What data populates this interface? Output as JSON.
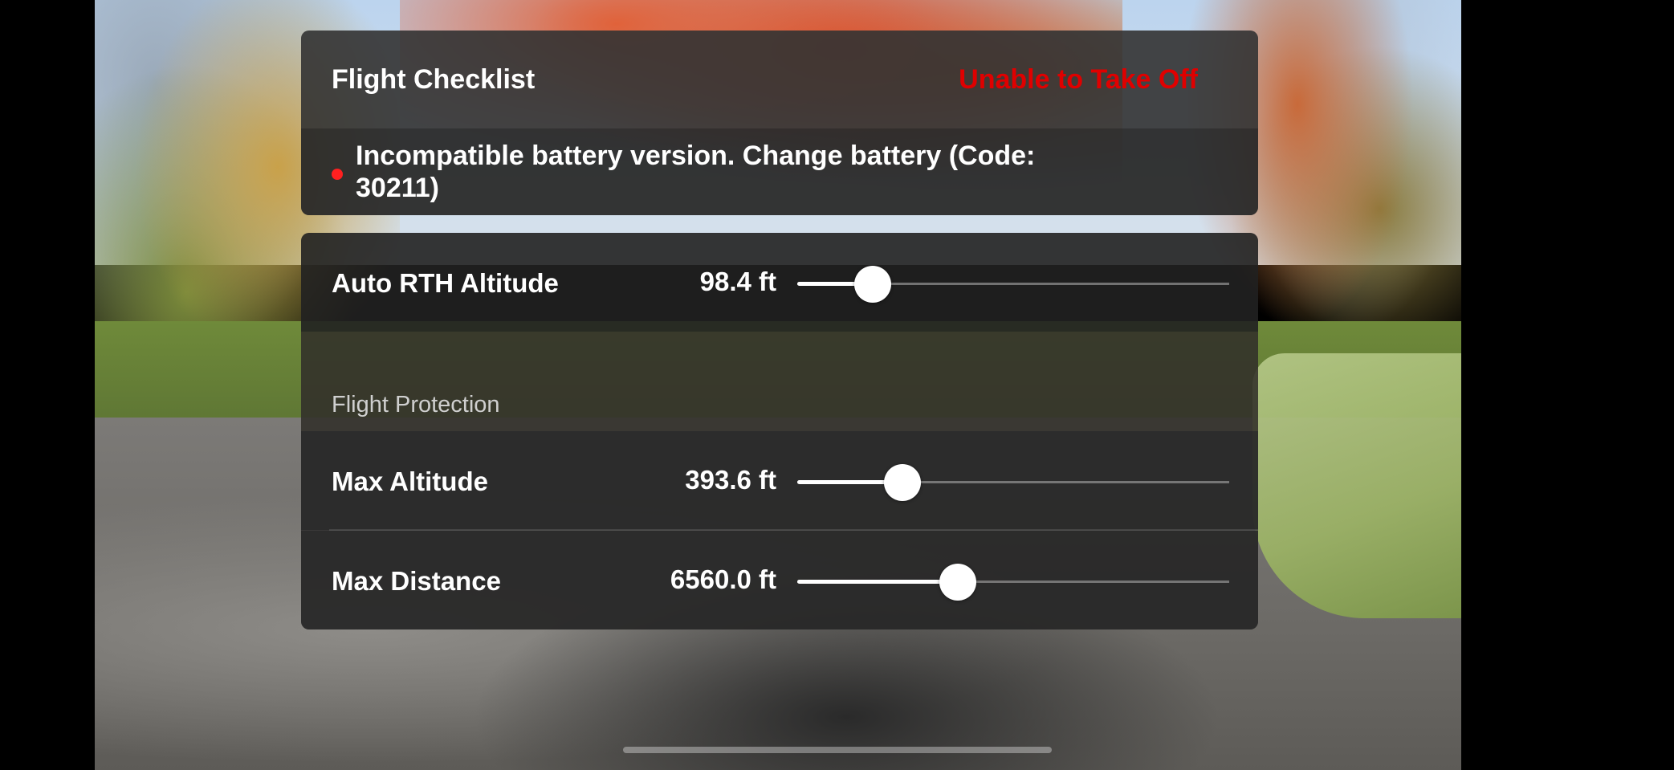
{
  "checklist": {
    "title": "Flight Checklist",
    "status": "Unable to Take Off",
    "status_color": "#e00000",
    "error_message": "Incompatible battery version. Change battery (Code: 30211)",
    "error_dot_color": "#ff2020"
  },
  "settings": {
    "rth": {
      "label": "Auto RTH Altitude",
      "value_text": "98.4 ft",
      "slider_fraction": 0.175
    },
    "section_title": "Flight Protection",
    "max_altitude": {
      "label": "Max Altitude",
      "value_text": "393.6 ft",
      "slider_fraction": 0.244
    },
    "max_distance": {
      "label": "Max Distance",
      "value_text": "6560.0 ft",
      "slider_fraction": 0.372
    }
  }
}
